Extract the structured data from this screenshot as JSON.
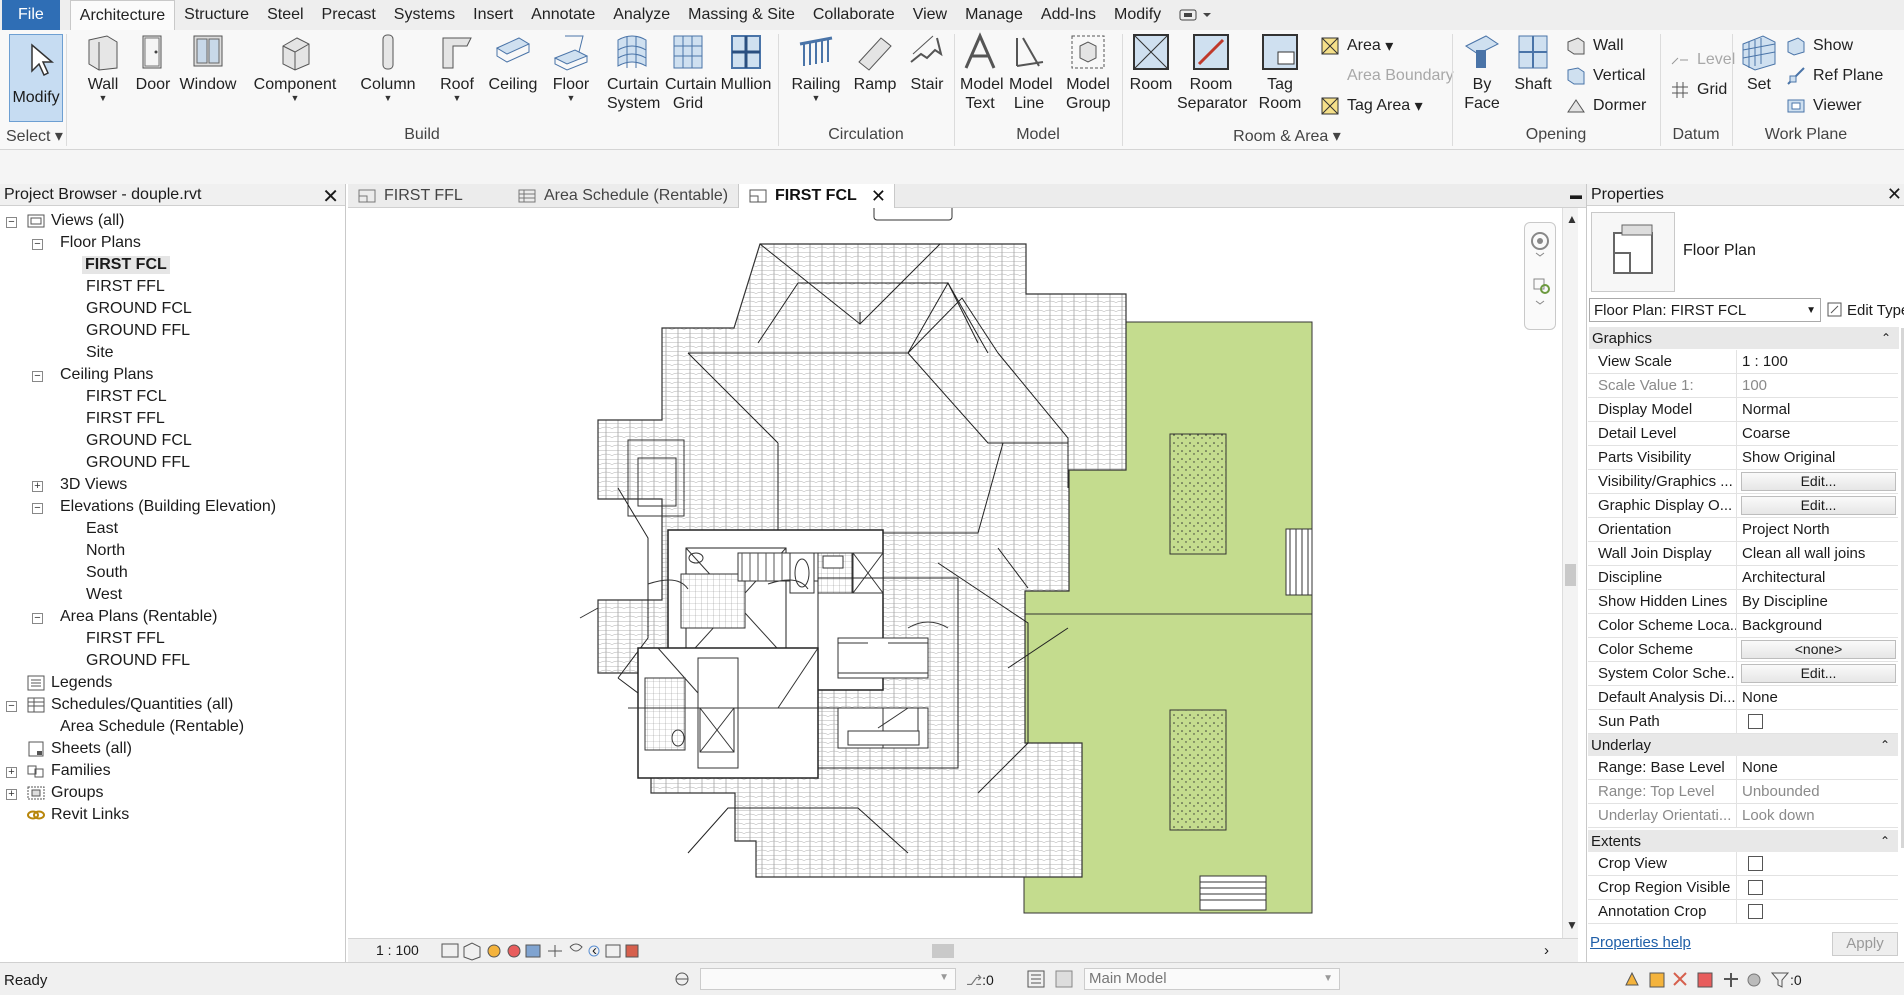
{
  "menu": {
    "file": "File",
    "tabs": [
      "Architecture",
      "Structure",
      "Steel",
      "Precast",
      "Systems",
      "Insert",
      "Annotate",
      "Analyze",
      "Massing & Site",
      "Collaborate",
      "View",
      "Manage",
      "Add-Ins",
      "Modify"
    ],
    "active": "Architecture"
  },
  "ribbon": {
    "modify": "Modify",
    "select": "Select",
    "build": {
      "label": "Build",
      "wall": "Wall",
      "door": "Door",
      "window": "Window",
      "component": "Component",
      "column": "Column",
      "roof": "Roof",
      "ceiling": "Ceiling",
      "floor": "Floor",
      "curtain_system": "Curtain System",
      "curtain_grid": "Curtain Grid",
      "mullion": "Mullion"
    },
    "circulation": {
      "label": "Circulation",
      "railing": "Railing",
      "ramp": "Ramp",
      "stair": "Stair"
    },
    "model": {
      "label": "Model",
      "model_text": "Model Text",
      "model_line": "Model Line",
      "model_group": "Model Group"
    },
    "room_area": {
      "label": "Room & Area",
      "room": "Room",
      "room_separator": "Room Separator",
      "tag_room": "Tag Room",
      "area": "Area",
      "area_boundary": "Area  Boundary",
      "tag_area": "Tag  Area"
    },
    "opening": {
      "label": "Opening",
      "by_face": "By Face",
      "shaft": "Shaft",
      "wall": "Wall",
      "vertical": "Vertical",
      "dormer": "Dormer"
    },
    "datum": {
      "label": "Datum",
      "level": "Level",
      "grid": "Grid"
    },
    "work_plane": {
      "label": "Work Plane",
      "set": "Set",
      "show": "Show",
      "ref_plane": "Ref  Plane",
      "viewer": "Viewer"
    }
  },
  "project_browser": {
    "title": "Project Browser - douple.rvt",
    "views": "Views (all)",
    "floor_plans": "Floor Plans",
    "fp": [
      "FIRST FCL",
      "FIRST FFL",
      "GROUND FCL",
      "GROUND FFL",
      "Site"
    ],
    "ceiling_plans": "Ceiling Plans",
    "cp": [
      "FIRST FCL",
      "FIRST FFL",
      "GROUND FCL",
      "GROUND FFL"
    ],
    "views_3d": "3D Views",
    "elevations": "Elevations (Building Elevation)",
    "el": [
      "East",
      "North",
      "South",
      "West"
    ],
    "area_plans": "Area Plans (Rentable)",
    "ap": [
      "FIRST FFL",
      "GROUND FFL"
    ],
    "legends": "Legends",
    "schedules": "Schedules/Quantities (all)",
    "area_schedule": "Area Schedule (Rentable)",
    "sheets": "Sheets (all)",
    "families": "Families",
    "groups": "Groups",
    "revit_links": "Revit Links"
  },
  "view_tabs": [
    "FIRST FFL",
    "Area Schedule (Rentable)",
    "FIRST FCL"
  ],
  "view_scale": "1 : 100",
  "properties": {
    "title": "Properties",
    "type_name": "Floor Plan",
    "type_selector": "Floor Plan: FIRST FCL",
    "edit_type": "Edit Type",
    "graphics": "Graphics",
    "rows": [
      [
        "View Scale",
        "1 : 100"
      ],
      [
        "Scale Value    1:",
        "100"
      ],
      [
        "Display Model",
        "Normal"
      ],
      [
        "Detail Level",
        "Coarse"
      ],
      [
        "Parts Visibility",
        "Show Original"
      ],
      [
        "Visibility/Graphics ...",
        "Edit..."
      ],
      [
        "Graphic Display O...",
        "Edit..."
      ],
      [
        "Orientation",
        "Project North"
      ],
      [
        "Wall Join Display",
        "Clean all wall joins"
      ],
      [
        "Discipline",
        "Architectural"
      ],
      [
        "Show Hidden Lines",
        "By Discipline"
      ],
      [
        "Color Scheme Loca...",
        "Background"
      ],
      [
        "Color Scheme",
        "<none>"
      ],
      [
        "System Color Sche...",
        "Edit..."
      ],
      [
        "Default Analysis Di...",
        "None"
      ],
      [
        "Sun Path",
        ""
      ]
    ],
    "underlay": "Underlay",
    "underlay_rows": [
      [
        "Range: Base Level",
        "None"
      ],
      [
        "Range: Top Level",
        "Unbounded"
      ],
      [
        "Underlay Orientati...",
        "Look down"
      ]
    ],
    "extents": "Extents",
    "extent_rows": [
      [
        "Crop View",
        ""
      ],
      [
        "Crop Region Visible",
        ""
      ],
      [
        "Annotation Crop",
        ""
      ]
    ],
    "help": "Properties help",
    "apply": "Apply"
  },
  "status": {
    "ready": "Ready",
    "zero": ":0",
    "model": "Main Model",
    "filter": ":0"
  },
  "colors": {
    "accent": "#2f6eb5",
    "site": "#c4dc8e"
  }
}
